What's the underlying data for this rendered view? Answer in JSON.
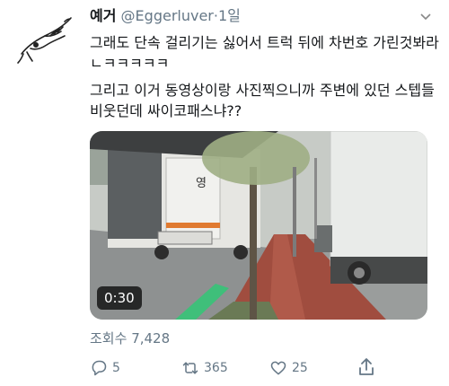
{
  "tweet": {
    "author_name": "예거",
    "handle": "@Eggerluver",
    "separator": "·",
    "time": "1일",
    "lines": [
      "그래도 단속 걸리기는 싫어서 트럭 뒤에 차번호 가린것봐라ㄴㅋㅋㅋㅋㅋ",
      "그리고 이거 동영상이랑 사진찍으니까 주변에 있던 스텝들 비웃던데 싸이코패스냐??"
    ]
  },
  "media": {
    "duration": "0:30",
    "truck_label": "영"
  },
  "stats": {
    "views_label": "조회수",
    "views_value": "7,428"
  },
  "actions": {
    "reply_count": "5",
    "retweet_count": "365",
    "like_count": "25"
  },
  "colors": {
    "text": "#14171a",
    "muted": "#657786"
  },
  "icons": [
    "avatar-bird-sketch",
    "chevron-down-icon",
    "reply-icon",
    "retweet-icon",
    "like-icon",
    "share-icon"
  ]
}
